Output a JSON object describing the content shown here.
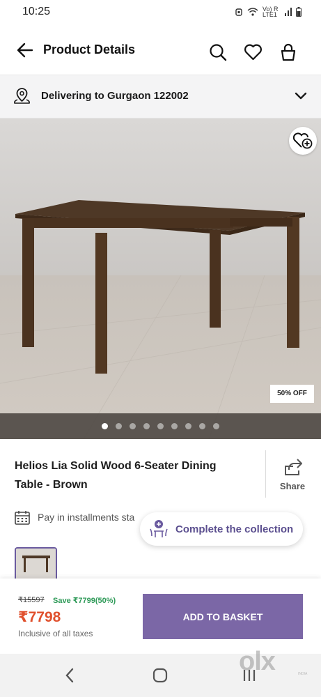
{
  "status_bar": {
    "time": "10:25",
    "network": "Vo) R LTE1"
  },
  "header": {
    "title": "Product Details"
  },
  "delivery": {
    "text": "Delivering to Gurgaon 122002"
  },
  "image": {
    "badge": "50% OFF",
    "dot_count": 9,
    "active_dot": 0
  },
  "product": {
    "name_line1": "Helios Lia Solid Wood 6-Seater Dining",
    "name_line2": "Table - Brown",
    "share_label": "Share"
  },
  "installments": {
    "text": "Pay in installments sta"
  },
  "collection": {
    "label": "Complete the collection"
  },
  "pricing": {
    "mrp": "₹15597",
    "save": "Save ₹7799(50%)",
    "price": "₹7798",
    "tax_note": "Inclusive of all taxes",
    "cta": "ADD TO BASKET"
  },
  "watermark": {
    "logo": "olx",
    "sub": "INDIA"
  },
  "colors": {
    "accent": "#7b67a6",
    "price": "#e0502d",
    "save": "#2e9a58"
  }
}
